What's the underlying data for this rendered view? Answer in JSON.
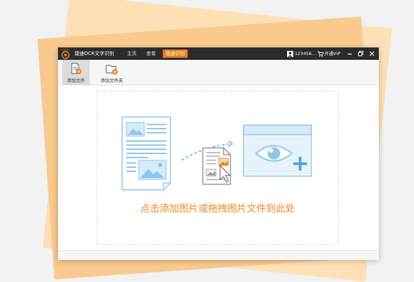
{
  "app": {
    "logo_text": "OCR",
    "title": "捷速OCR文字识别",
    "nav": [
      {
        "label": "主页"
      },
      {
        "label": "查看"
      },
      {
        "label": "极速识别"
      }
    ],
    "user_id": "123456...",
    "vip_label": "开通VIP"
  },
  "toolbar": {
    "add_file": "添加文件",
    "add_folder": "添加文件夹"
  },
  "dropzone": {
    "hint": "点击添加图片或拖拽图片文件到此处"
  },
  "colors": {
    "accent": "#e87d1e",
    "titlebar": "#2b2b2b",
    "illustration": "#8ec6ec"
  }
}
